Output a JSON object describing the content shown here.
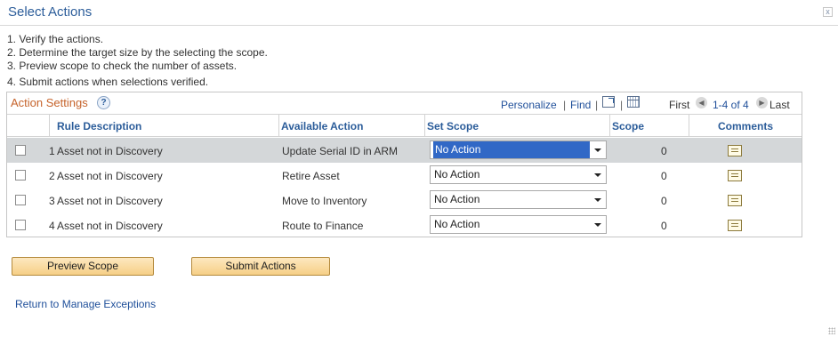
{
  "dialog": {
    "title": "Select Actions",
    "close_label": "x"
  },
  "instructions": [
    "1. Verify the actions.",
    "2. Determine the target size by the selecting the scope.",
    "3. Preview scope to check the number of assets.",
    "4. Submit actions when selections verified."
  ],
  "grid": {
    "title": "Action Settings",
    "help_label": "?",
    "personalize": "Personalize",
    "separator": "|",
    "find": "Find",
    "first": "First",
    "range": "1-4 of 4",
    "last": "Last",
    "headers": {
      "rule_description": "Rule Description",
      "available_action": "Available Action",
      "set_scope": "Set Scope",
      "scope": "Scope",
      "comments": "Comments"
    },
    "rows": [
      {
        "num": "1",
        "rule": "Asset not in Discovery",
        "action": "Update Serial ID in ARM",
        "scope_select": "No Action",
        "scope": "0"
      },
      {
        "num": "2",
        "rule": "Asset not in Discovery",
        "action": "Retire Asset",
        "scope_select": "No Action",
        "scope": "0"
      },
      {
        "num": "3",
        "rule": "Asset not in Discovery",
        "action": "Move to Inventory",
        "scope_select": "No Action",
        "scope": "0"
      },
      {
        "num": "4",
        "rule": "Asset not in Discovery",
        "action": "Route to Finance",
        "scope_select": "No Action",
        "scope": "0"
      }
    ]
  },
  "buttons": {
    "preview_scope": "Preview Scope",
    "submit_actions": "Submit Actions"
  },
  "links": {
    "return": "Return to Manage Exceptions"
  },
  "colors": {
    "title": "#2c5d9a",
    "grid_title": "#c6632b",
    "link": "#1f4f9a",
    "selected_row": "#d4d7d9",
    "button": "#f6cf86"
  }
}
